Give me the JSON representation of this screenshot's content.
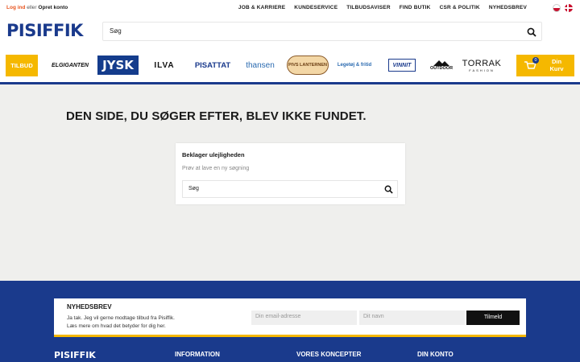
{
  "topbar": {
    "login": "Log ind",
    "or": "eller",
    "create": "Opret konto",
    "nav": [
      "JOB & KARRIERE",
      "KUNDESERVICE",
      "TILBUDSAVISER",
      "FIND BUTIK",
      "CSR & POLITIK",
      "NYHEDSBREV"
    ]
  },
  "header": {
    "logo": "PISIFFIK",
    "search_text": "Søg"
  },
  "brands": {
    "tilbud": "TILBUD",
    "items": [
      "ELGIGANTEN",
      "JYSK",
      "ILVA",
      "PISATTAT",
      "thansen",
      "PIVS LANTERNEN",
      "Legetøj & fritid",
      "VINNIT",
      "OUTDOOR",
      "TORRAK",
      "FASHION"
    ],
    "cart_count": "0",
    "cart_line1": "Din",
    "cart_line2": "Kurv"
  },
  "main": {
    "heading": "DEN SIDE, DU SØGER EFTER, BLEV IKKE FUNDET.",
    "card_title": "Beklager ulejligheden",
    "card_sub": "Prøv at lave en ny søgning",
    "card_search": "Søg"
  },
  "footer": {
    "nl_title": "NYHEDSBREV",
    "nl_desc1": "Ja tak. Jeg vil gerne modtage tilbud fra Pisiffik.",
    "nl_desc2": "Læs mere om hvad det betyder for dig her.",
    "email_placeholder": "Din email-adresse",
    "name_placeholder": "Dit navn",
    "submit": "Tilmeld",
    "logo": "PISIFFIK",
    "col1": "INFORMATION",
    "col2": "VORES KONCEPTER",
    "col3": "DIN KONTO"
  },
  "colors": {
    "brand_blue": "#1a3a8c",
    "yellow": "#f5b800",
    "orange": "#e8541e"
  }
}
